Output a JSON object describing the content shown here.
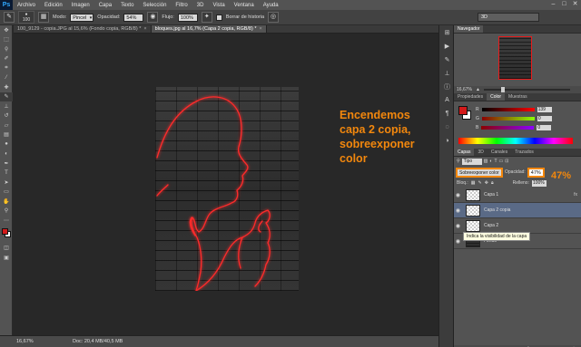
{
  "app": {
    "logo": "Ps",
    "menu": [
      "Archivo",
      "Edición",
      "Imagen",
      "Capa",
      "Texto",
      "Selección",
      "Filtro",
      "3D",
      "Vista",
      "Ventana",
      "Ayuda"
    ],
    "window_controls": [
      "–",
      "□",
      "✕"
    ]
  },
  "options_bar": {
    "brush_size": "100",
    "mode_label": "Modo:",
    "mode_value": "Pincel",
    "opacity_label": "Opacidad:",
    "opacity_value": "54%",
    "flow_label": "Flujo:",
    "flow_value": "100%",
    "history_label": "Borrar de historia",
    "workspace": "3D"
  },
  "tabs": [
    {
      "label": "100_9129 - copia.JPG al 15,6% (Fondo copia, RGB/8) *",
      "active": false
    },
    {
      "label": "bloques.jpg al 16,7% (Capa 2 copia, RGB/8) *",
      "active": true
    }
  ],
  "annotation": {
    "line1": "Encendemos",
    "line2": "capa 2 copia,",
    "line3": "sobreexponer",
    "line4": "color"
  },
  "status": {
    "zoom": "16,67%",
    "doc_size": "Doc: 20,4 MB/40,5 MB"
  },
  "navigator": {
    "tabs": [
      "Navegador"
    ],
    "zoom": "16,67%"
  },
  "properties": {
    "tabs": [
      "Propiedades",
      "Color",
      "Muestras"
    ],
    "r_label": "R",
    "r_value": "139",
    "g_label": "G",
    "g_value": "0",
    "b_label": "B",
    "b_value": "0"
  },
  "layers": {
    "tabs": [
      "Capas",
      "3D",
      "Canales",
      "Trazados"
    ],
    "kind": "Tipo",
    "blend_mode": "Sobreexponer color",
    "opacity_label": "Opacidad:",
    "opacity_value": "47%",
    "opacity_big": "47%",
    "lock_label": "Bloq.:",
    "fill_label": "Relleno:",
    "fill_value": "100%",
    "items": [
      {
        "name": "Capa 1",
        "dark": false,
        "selected": false,
        "fx": "fx"
      },
      {
        "name": "Capa 2 copia",
        "dark": false,
        "selected": true,
        "fx": ""
      },
      {
        "name": "Capa 2",
        "dark": false,
        "selected": false,
        "fx": ""
      },
      {
        "name": "Fondo",
        "dark": true,
        "selected": false,
        "fx": ""
      }
    ],
    "tooltip": "Indica la visibilidad de la capa",
    "footer_icons": [
      "link-icon",
      "fx-icon",
      "mask-icon",
      "adjustment-icon",
      "folder-icon",
      "new-layer-icon",
      "trash-icon"
    ]
  },
  "colors": {
    "foreground": "#d31a1a",
    "background": "#ffffff",
    "accent": "#f2870d",
    "neon": "#ff2a2a"
  }
}
